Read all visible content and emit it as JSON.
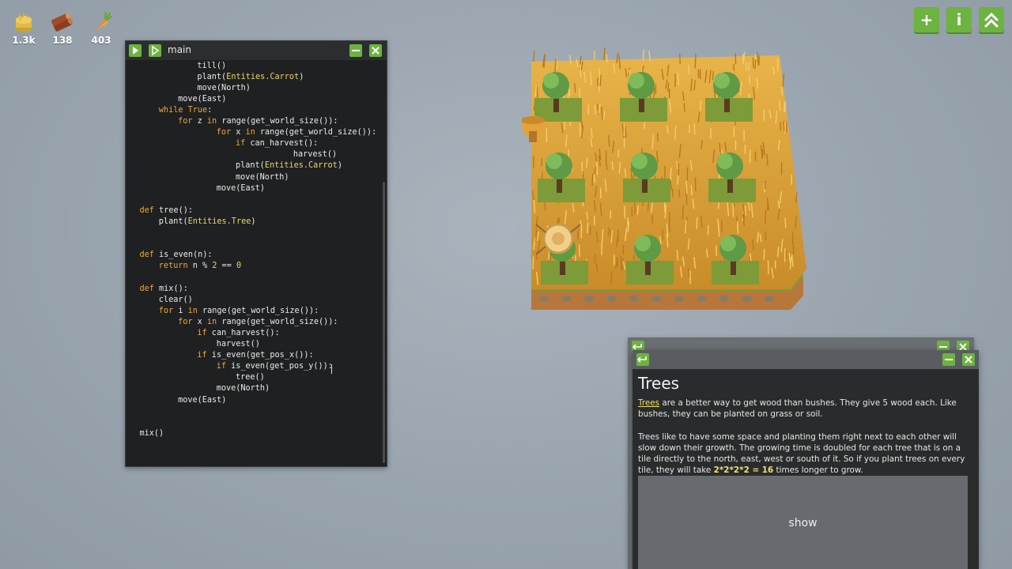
{
  "resources": [
    {
      "icon": "hay-icon",
      "value": "1.3k"
    },
    {
      "icon": "wood-icon",
      "value": "138"
    },
    {
      "icon": "carrot-icon",
      "value": "403"
    }
  ],
  "top_buttons": {
    "add": "+",
    "info": "i",
    "up": "⌃"
  },
  "code_window": {
    "title": "main",
    "lines": [
      {
        "indent": 3,
        "tokens": [
          [
            "fn",
            "till()"
          ]
        ]
      },
      {
        "indent": 3,
        "tokens": [
          [
            "fn",
            "plant("
          ],
          [
            "ent",
            "Entities.Carrot"
          ],
          [
            "fn",
            ")"
          ]
        ]
      },
      {
        "indent": 3,
        "tokens": [
          [
            "fn",
            "move(North)"
          ]
        ]
      },
      {
        "indent": 2,
        "tokens": [
          [
            "fn",
            "move(East)"
          ]
        ]
      },
      {
        "indent": 1,
        "tokens": [
          [
            "kw",
            "while True"
          ],
          [
            "fn",
            ":"
          ]
        ]
      },
      {
        "indent": 2,
        "tokens": [
          [
            "kw",
            "for"
          ],
          [
            "fn",
            " z "
          ],
          [
            "kw",
            "in"
          ],
          [
            "fn",
            " range(get_world_size()):"
          ]
        ]
      },
      {
        "indent": 4,
        "tokens": [
          [
            "kw",
            "for"
          ],
          [
            "fn",
            " x "
          ],
          [
            "kw",
            "in"
          ],
          [
            "fn",
            " range(get_world_size()):"
          ]
        ]
      },
      {
        "indent": 5,
        "tokens": [
          [
            "kw",
            "if"
          ],
          [
            "fn",
            " can_harvest():"
          ]
        ]
      },
      {
        "indent": 8,
        "tokens": [
          [
            "fn",
            "harvest()"
          ]
        ]
      },
      {
        "indent": 5,
        "tokens": [
          [
            "fn",
            "plant("
          ],
          [
            "ent",
            "Entities.Carrot"
          ],
          [
            "fn",
            ")"
          ]
        ]
      },
      {
        "indent": 5,
        "tokens": [
          [
            "fn",
            "move(North)"
          ]
        ]
      },
      {
        "indent": 4,
        "tokens": [
          [
            "fn",
            "move(East)"
          ]
        ]
      },
      {
        "indent": 0,
        "tokens": []
      },
      {
        "indent": 0,
        "tokens": [
          [
            "kw",
            "def"
          ],
          [
            "fn",
            " tree():"
          ]
        ]
      },
      {
        "indent": 1,
        "tokens": [
          [
            "fn",
            "plant("
          ],
          [
            "ent",
            "Entities.Tree"
          ],
          [
            "fn",
            ")"
          ]
        ]
      },
      {
        "indent": 0,
        "tokens": []
      },
      {
        "indent": 0,
        "tokens": []
      },
      {
        "indent": 0,
        "tokens": [
          [
            "kw",
            "def"
          ],
          [
            "fn",
            " is_even(n):"
          ]
        ]
      },
      {
        "indent": 1,
        "tokens": [
          [
            "kw",
            "return"
          ],
          [
            "fn",
            " n % "
          ],
          [
            "num",
            "2"
          ],
          [
            "fn",
            " == "
          ],
          [
            "num",
            "0"
          ]
        ]
      },
      {
        "indent": 0,
        "tokens": []
      },
      {
        "indent": 0,
        "tokens": [
          [
            "kw",
            "def"
          ],
          [
            "fn",
            " mix():"
          ]
        ]
      },
      {
        "indent": 1,
        "tokens": [
          [
            "fn",
            "clear()"
          ]
        ]
      },
      {
        "indent": 1,
        "tokens": [
          [
            "kw",
            "for"
          ],
          [
            "fn",
            " i "
          ],
          [
            "kw",
            "in"
          ],
          [
            "fn",
            " range(get_world_size()):"
          ]
        ]
      },
      {
        "indent": 2,
        "tokens": [
          [
            "kw",
            "for"
          ],
          [
            "fn",
            " x "
          ],
          [
            "kw",
            "in"
          ],
          [
            "fn",
            " range(get_world_size()):"
          ]
        ]
      },
      {
        "indent": 3,
        "tokens": [
          [
            "kw",
            "if"
          ],
          [
            "fn",
            " can_harvest():"
          ]
        ]
      },
      {
        "indent": 4,
        "tokens": [
          [
            "fn",
            "harvest()"
          ]
        ]
      },
      {
        "indent": 3,
        "tokens": [
          [
            "kw",
            "if"
          ],
          [
            "fn",
            " is_even(get_pos_x()):"
          ]
        ]
      },
      {
        "indent": 4,
        "tokens": [
          [
            "kw",
            "if"
          ],
          [
            "fn",
            " is_even(get_pos_y()):"
          ]
        ]
      },
      {
        "indent": 5,
        "tokens": [
          [
            "fn",
            "tree()"
          ]
        ]
      },
      {
        "indent": 4,
        "tokens": [
          [
            "fn",
            "move(North)"
          ]
        ]
      },
      {
        "indent": 2,
        "tokens": [
          [
            "fn",
            "move(East)"
          ]
        ]
      },
      {
        "indent": 0,
        "tokens": []
      },
      {
        "indent": 0,
        "tokens": []
      },
      {
        "indent": 0,
        "tokens": [
          [
            "fn",
            "mix()"
          ]
        ]
      }
    ]
  },
  "info_panel": {
    "title": "Trees",
    "p1_link": "Trees",
    "p1_rest": " are a better way to get wood than bushes. They give 5 wood each. Like bushes, they can be planted on grass or soil.",
    "p2_a": "Trees like to have some space and planting them right next to each other will slow down their growth. The growing time is doubled for each tree that is on a tile directly to the north, east, west or south of it. So if you plant trees on every tile, they will take ",
    "p2_expr": "2*2*2*2 = 16",
    "p2_b": " times longer to grow.",
    "show_label": "show"
  },
  "colors": {
    "accent": "#6db33f",
    "keyword": "#f0a63b",
    "entity": "#e9d66b"
  }
}
